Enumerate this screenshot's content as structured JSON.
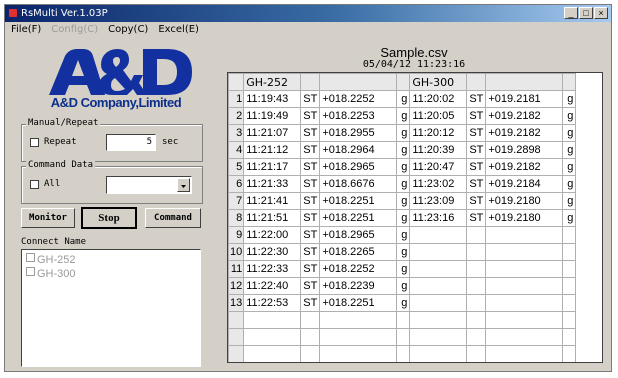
{
  "window": {
    "title": "RsMulti Ver.1.03P",
    "btn_min": "_",
    "btn_max": "□",
    "btn_close": "×"
  },
  "menu": {
    "file": "File(F)",
    "config": "Config(C)",
    "copy": "Copy(C)",
    "excel": "Excel(E)"
  },
  "brand": {
    "company": "A&D Company,Limited"
  },
  "manual_repeat": {
    "group_label": "Manual/Repeat",
    "checkbox_label": "Repeat",
    "interval_value": "5",
    "unit": "sec"
  },
  "command_data": {
    "group_label": "Command Data",
    "checkbox_label": "All",
    "selected": ""
  },
  "buttons": {
    "monitor": "Monitor",
    "stop": "Stop",
    "command": "Command"
  },
  "connect": {
    "label": "Connect Name",
    "items": [
      "GH-252",
      "GH-300"
    ]
  },
  "file": {
    "name": "Sample.csv",
    "datetime": "05/04/12 11:23:16"
  },
  "table": {
    "col_groups": [
      "GH-252",
      "GH-300"
    ],
    "rows": [
      {
        "n": "1",
        "t1": "11:19:43",
        "s1": "ST",
        "v1": "+018.2252",
        "u1": "g",
        "t2": "11:20:02",
        "s2": "ST",
        "v2": "+019.2181",
        "u2": "g"
      },
      {
        "n": "2",
        "t1": "11:19:49",
        "s1": "ST",
        "v1": "+018.2253",
        "u1": "g",
        "t2": "11:20:05",
        "s2": "ST",
        "v2": "+019.2182",
        "u2": "g"
      },
      {
        "n": "3",
        "t1": "11:21:07",
        "s1": "ST",
        "v1": "+018.2955",
        "u1": "g",
        "t2": "11:20:12",
        "s2": "ST",
        "v2": "+019.2182",
        "u2": "g"
      },
      {
        "n": "4",
        "t1": "11:21:12",
        "s1": "ST",
        "v1": "+018.2964",
        "u1": "g",
        "t2": "11:20:39",
        "s2": "ST",
        "v2": "+019.2898",
        "u2": "g"
      },
      {
        "n": "5",
        "t1": "11:21:17",
        "s1": "ST",
        "v1": "+018.2965",
        "u1": "g",
        "t2": "11:20:47",
        "s2": "ST",
        "v2": "+019.2182",
        "u2": "g"
      },
      {
        "n": "6",
        "t1": "11:21:33",
        "s1": "ST",
        "v1": "+018.6676",
        "u1": "g",
        "t2": "11:23:02",
        "s2": "ST",
        "v2": "+019.2184",
        "u2": "g"
      },
      {
        "n": "7",
        "t1": "11:21:41",
        "s1": "ST",
        "v1": "+018.2251",
        "u1": "g",
        "t2": "11:23:09",
        "s2": "ST",
        "v2": "+019.2180",
        "u2": "g"
      },
      {
        "n": "8",
        "t1": "11:21:51",
        "s1": "ST",
        "v1": "+018.2251",
        "u1": "g",
        "t2": "11:23:16",
        "s2": "ST",
        "v2": "+019.2180",
        "u2": "g"
      },
      {
        "n": "9",
        "t1": "11:22:00",
        "s1": "ST",
        "v1": "+018.2965",
        "u1": "g",
        "t2": "",
        "s2": "",
        "v2": "",
        "u2": ""
      },
      {
        "n": "10",
        "t1": "11:22:30",
        "s1": "ST",
        "v1": "+018.2265",
        "u1": "g",
        "t2": "",
        "s2": "",
        "v2": "",
        "u2": ""
      },
      {
        "n": "11",
        "t1": "11:22:33",
        "s1": "ST",
        "v1": "+018.2252",
        "u1": "g",
        "t2": "",
        "s2": "",
        "v2": "",
        "u2": ""
      },
      {
        "n": "12",
        "t1": "11:22:40",
        "s1": "ST",
        "v1": "+018.2239",
        "u1": "g",
        "t2": "",
        "s2": "",
        "v2": "",
        "u2": ""
      },
      {
        "n": "13",
        "t1": "11:22:53",
        "s1": "ST",
        "v1": "+018.2251",
        "u1": "g",
        "t2": "",
        "s2": "",
        "v2": "",
        "u2": ""
      }
    ]
  },
  "colors": {
    "logo_blue": "#1230a0",
    "title_bar": "#0a246a",
    "window_bg": "#d4d0c8"
  }
}
